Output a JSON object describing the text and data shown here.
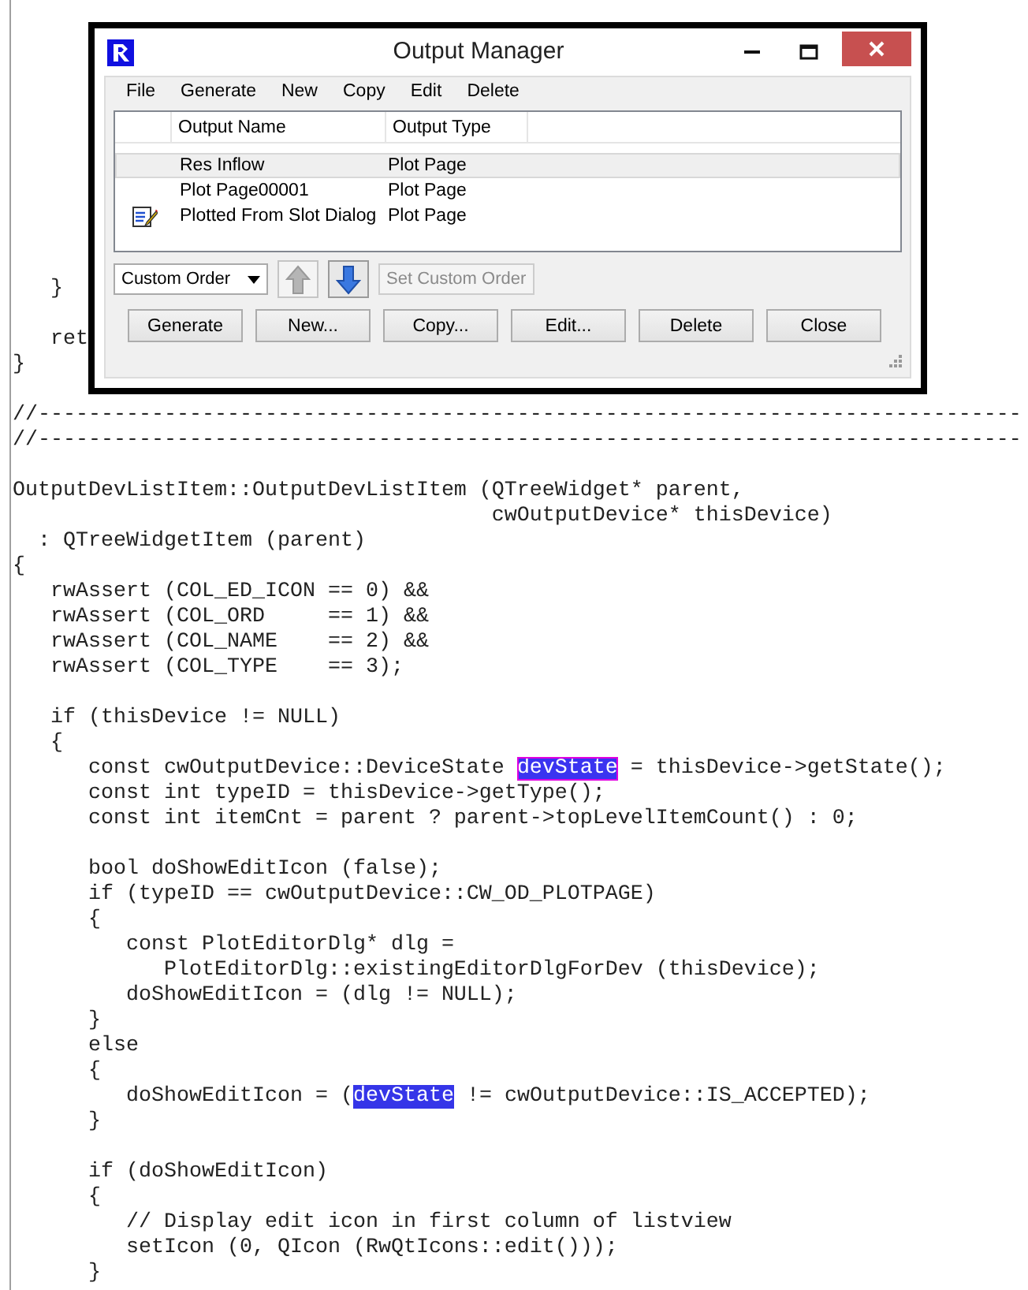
{
  "code_lines": [
    {
      "kind": "code",
      "parts": [
        {
          "text": "   }"
        }
      ]
    },
    {
      "kind": "blank"
    },
    {
      "kind": "code",
      "parts": [
        {
          "text": "   ret"
        }
      ]
    },
    {
      "kind": "code",
      "parts": [
        {
          "text": "}"
        }
      ]
    },
    {
      "kind": "blank"
    },
    {
      "kind": "code",
      "parts": [
        {
          "text": "//------------------------------------------------------------------------------"
        }
      ]
    },
    {
      "kind": "code",
      "parts": [
        {
          "text": "//------------------------------------------------------------------------------"
        }
      ]
    },
    {
      "kind": "blank"
    },
    {
      "kind": "code",
      "parts": [
        {
          "text": "OutputDevListItem::OutputDevListItem (QTreeWidget* parent,"
        }
      ]
    },
    {
      "kind": "code",
      "parts": [
        {
          "text": "                                      cwOutputDevice* thisDevice)"
        }
      ]
    },
    {
      "kind": "code",
      "parts": [
        {
          "text": "  : QTreeWidgetItem (parent)"
        }
      ]
    },
    {
      "kind": "code",
      "parts": [
        {
          "text": "{"
        }
      ]
    },
    {
      "kind": "code",
      "parts": [
        {
          "text": "   rwAssert (COL_ED_ICON == 0) &&"
        }
      ]
    },
    {
      "kind": "code",
      "parts": [
        {
          "text": "   rwAssert (COL_ORD     == 1) &&"
        }
      ]
    },
    {
      "kind": "code",
      "parts": [
        {
          "text": "   rwAssert (COL_NAME    == 2) &&"
        }
      ]
    },
    {
      "kind": "code",
      "parts": [
        {
          "text": "   rwAssert (COL_TYPE    == 3);"
        }
      ]
    },
    {
      "kind": "blank"
    },
    {
      "kind": "code",
      "parts": [
        {
          "text": "   if (thisDevice != NULL)"
        }
      ]
    },
    {
      "kind": "code",
      "parts": [
        {
          "text": "   {"
        }
      ]
    },
    {
      "kind": "code",
      "parts": [
        {
          "text": "      const cwOutputDevice::DeviceState "
        },
        {
          "text": "devState",
          "highlighted": true,
          "cursor": true
        },
        {
          "text": " = thisDevice->getState();"
        }
      ]
    },
    {
      "kind": "code",
      "parts": [
        {
          "text": "      const int typeID = thisDevice->getType();"
        }
      ]
    },
    {
      "kind": "code",
      "parts": [
        {
          "text": "      const int itemCnt = parent ? parent->topLevelItemCount() : 0;"
        }
      ]
    },
    {
      "kind": "blank"
    },
    {
      "kind": "code",
      "parts": [
        {
          "text": "      bool doShowEditIcon (false);"
        }
      ]
    },
    {
      "kind": "code",
      "parts": [
        {
          "text": "      if (typeID == cwOutputDevice::CW_OD_PLOTPAGE)"
        }
      ]
    },
    {
      "kind": "code",
      "parts": [
        {
          "text": "      {"
        }
      ]
    },
    {
      "kind": "code",
      "parts": [
        {
          "text": "         const PlotEditorDlg* dlg ="
        }
      ]
    },
    {
      "kind": "code",
      "parts": [
        {
          "text": "            PlotEditorDlg::existingEditorDlgForDev (thisDevice);"
        }
      ]
    },
    {
      "kind": "code",
      "parts": [
        {
          "text": "         doShowEditIcon = (dlg != NULL);"
        }
      ]
    },
    {
      "kind": "code",
      "parts": [
        {
          "text": "      }"
        }
      ]
    },
    {
      "kind": "code",
      "parts": [
        {
          "text": "      else"
        }
      ]
    },
    {
      "kind": "code",
      "parts": [
        {
          "text": "      {"
        }
      ]
    },
    {
      "kind": "code",
      "parts": [
        {
          "text": "         doShowEditIcon = ("
        },
        {
          "text": "devState",
          "highlighted": true,
          "cursor": false
        },
        {
          "text": " != cwOutputDevice::IS_ACCEPTED);"
        }
      ]
    },
    {
      "kind": "code",
      "parts": [
        {
          "text": "      }"
        }
      ]
    },
    {
      "kind": "blank"
    },
    {
      "kind": "code",
      "parts": [
        {
          "text": "      if (doShowEditIcon)"
        }
      ]
    },
    {
      "kind": "code",
      "parts": [
        {
          "text": "      {"
        }
      ]
    },
    {
      "kind": "code",
      "parts": [
        {
          "text": "         // Display edit icon in first column of listview"
        }
      ]
    },
    {
      "kind": "code",
      "parts": [
        {
          "text": "         setIcon (0, QIcon (RwQtIcons::edit()));"
        }
      ]
    },
    {
      "kind": "code",
      "parts": [
        {
          "text": "      }"
        }
      ]
    }
  ],
  "dialog": {
    "title": "Output Manager",
    "menu": [
      "File",
      "Generate",
      "New",
      "Copy",
      "Edit",
      "Delete"
    ],
    "columns": [
      "Output Name",
      "Output Type"
    ],
    "rows": [
      {
        "name": "Res Inflow",
        "type": "Plot Page",
        "selected": true,
        "edit_icon": false
      },
      {
        "name": "Plot Page00001",
        "type": "Plot Page",
        "selected": false,
        "edit_icon": false
      },
      {
        "name": "Plotted From Slot Dialog",
        "type": "Plot Page",
        "selected": false,
        "edit_icon": true
      }
    ],
    "order_select": "Custom Order",
    "move_up": {
      "disabled": true
    },
    "move_down": {
      "disabled": false
    },
    "set_order": {
      "label": "Set Custom Order",
      "disabled": true
    },
    "buttons": [
      "Generate",
      "New...",
      "Copy...",
      "Edit...",
      "Delete",
      "Close"
    ]
  }
}
